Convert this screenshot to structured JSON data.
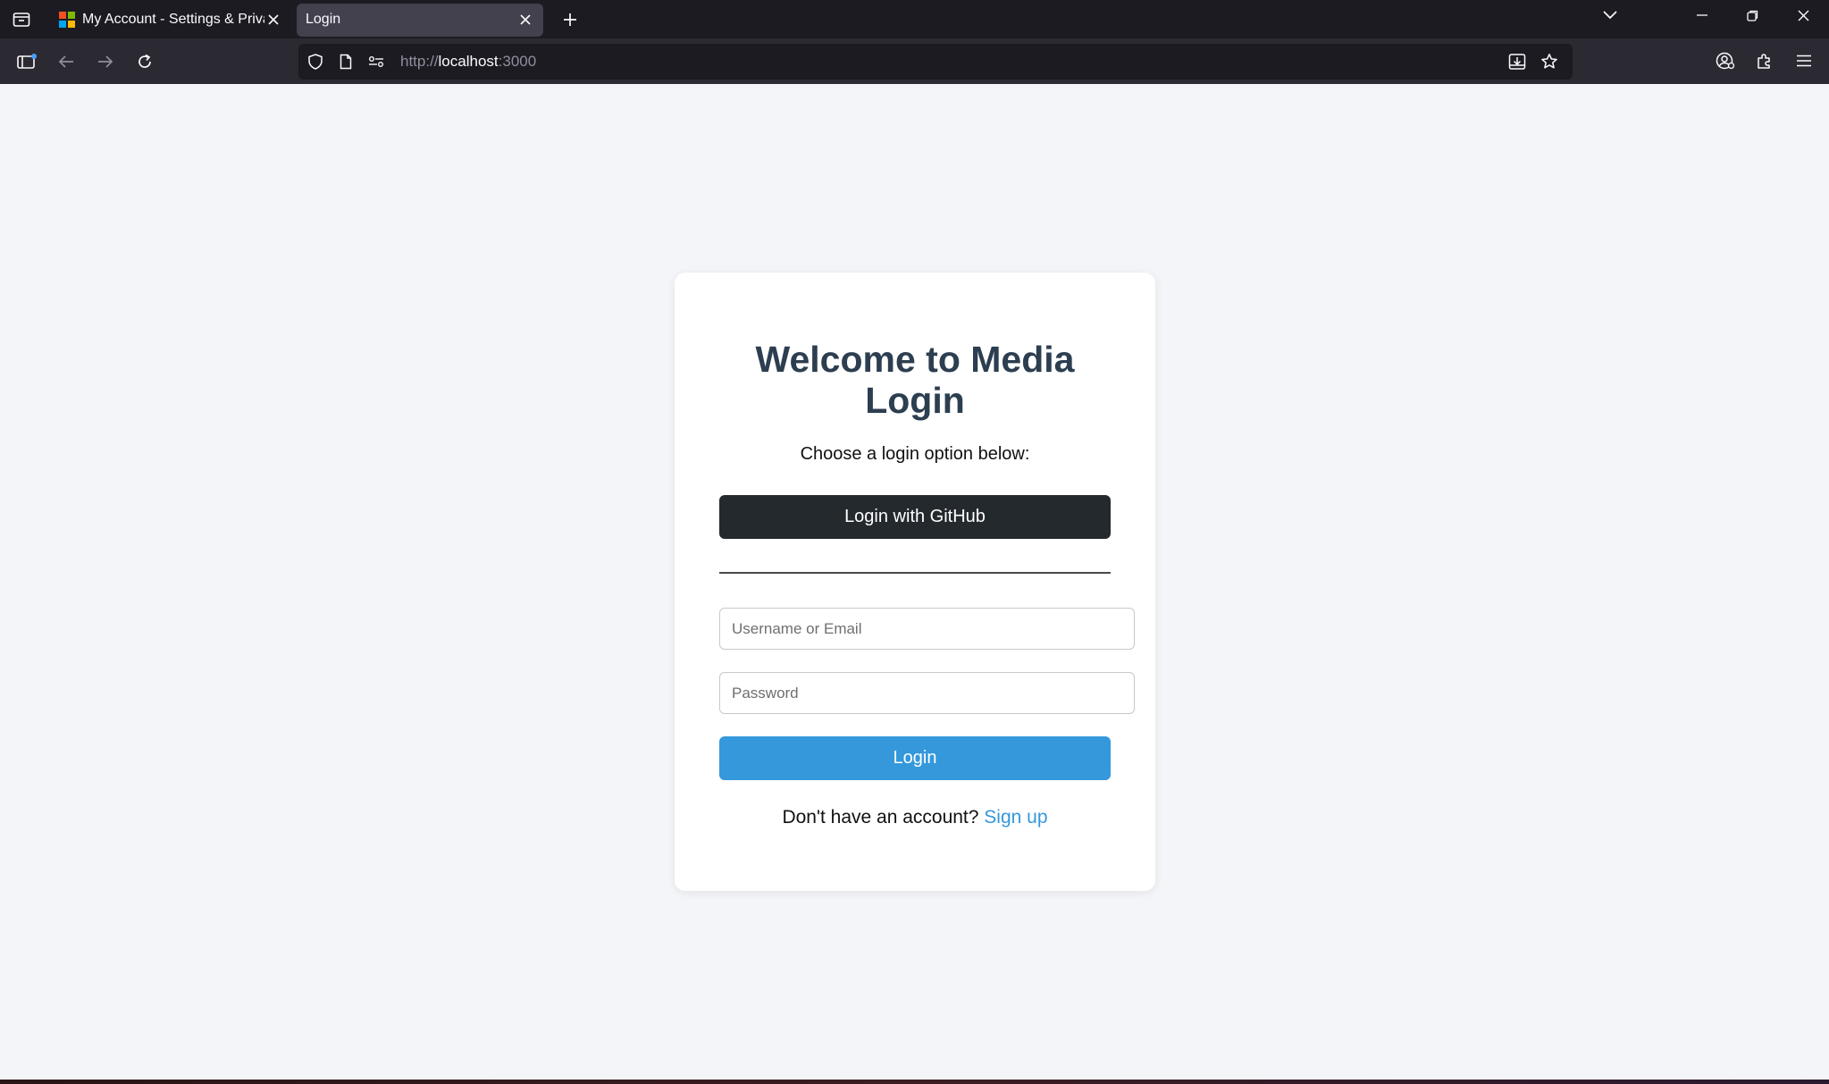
{
  "browser": {
    "tabs": [
      {
        "title": "My Account - Settings & Privacy",
        "active": false
      },
      {
        "title": "Login",
        "active": true
      }
    ],
    "url_prefix": "http://",
    "url_host": "localhost",
    "url_port": ":3000"
  },
  "page": {
    "title": "Welcome to Media Login",
    "subtitle": "Choose a login option below:",
    "github_button": "Login with GitHub",
    "username_placeholder": "Username or Email",
    "password_placeholder": "Password",
    "login_button": "Login",
    "signup_prompt": "Don't have an account?",
    "signup_link": "Sign up"
  },
  "colors": {
    "heading": "#2c3e50",
    "github_button": "#24292e",
    "login_button": "#3498db",
    "link": "#3498db",
    "page_background": "#f4f5f8"
  }
}
